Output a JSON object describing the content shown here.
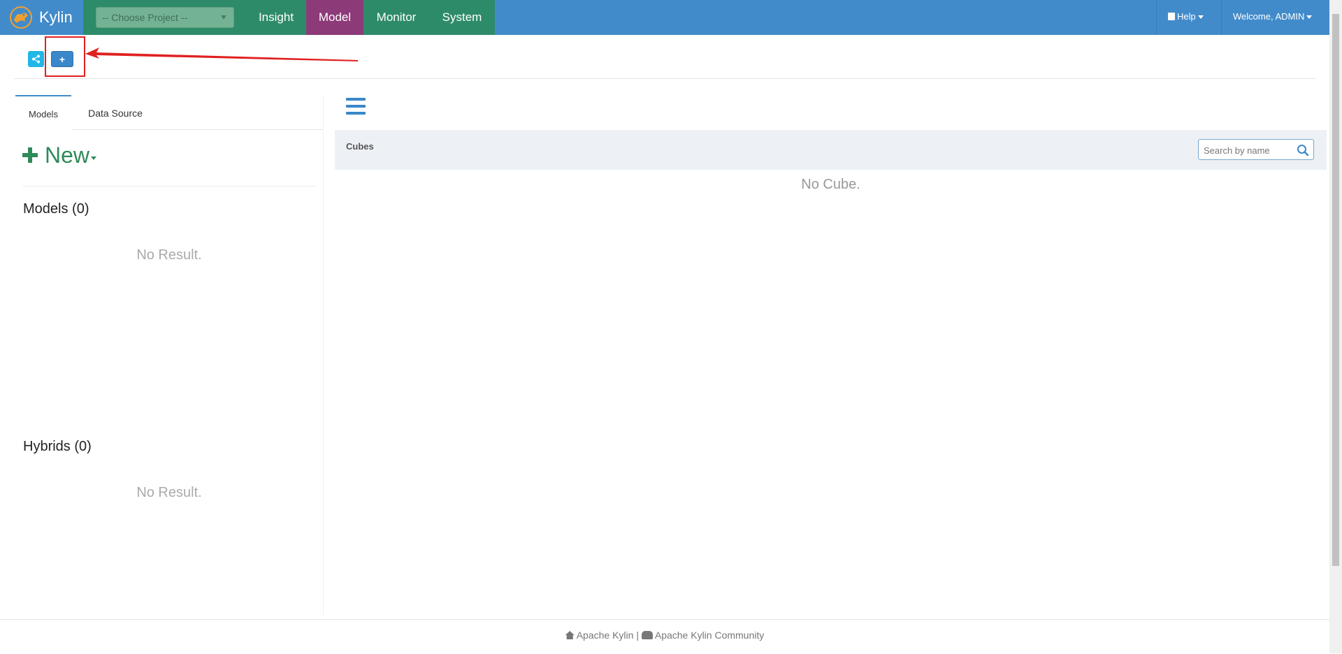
{
  "navbar": {
    "brand": "Kylin",
    "project_select": "-- Choose Project --",
    "items": [
      {
        "label": "Insight"
      },
      {
        "label": "Model"
      },
      {
        "label": "Monitor"
      },
      {
        "label": "System"
      }
    ],
    "help_label": "Help",
    "welcome_label": "Welcome, ADMIN",
    "colors": {
      "navbar": "#428bca",
      "nav_green": "#2e8b6a",
      "nav_active": "#8d3a79"
    }
  },
  "toolbar": {
    "model_design_icon": "share-alt-icon",
    "add_project_icon": "plus-icon",
    "add_project_symbol": "+",
    "annotation_color": "#e02020"
  },
  "left_panel": {
    "tabs": [
      {
        "label": "Models"
      },
      {
        "label": "Data Source"
      }
    ],
    "new_button": "New",
    "models_title": "Models (0)",
    "models_empty": "No Result.",
    "hybrids_title": "Hybrids (0)",
    "hybrids_empty": "No Result."
  },
  "right_panel": {
    "cubes_title": "Cubes",
    "search_placeholder": "Search by name",
    "empty_text": "No Cube."
  },
  "footer": {
    "link1": "Apache Kylin",
    "separator": "|",
    "link2": "Apache Kylin Community"
  }
}
